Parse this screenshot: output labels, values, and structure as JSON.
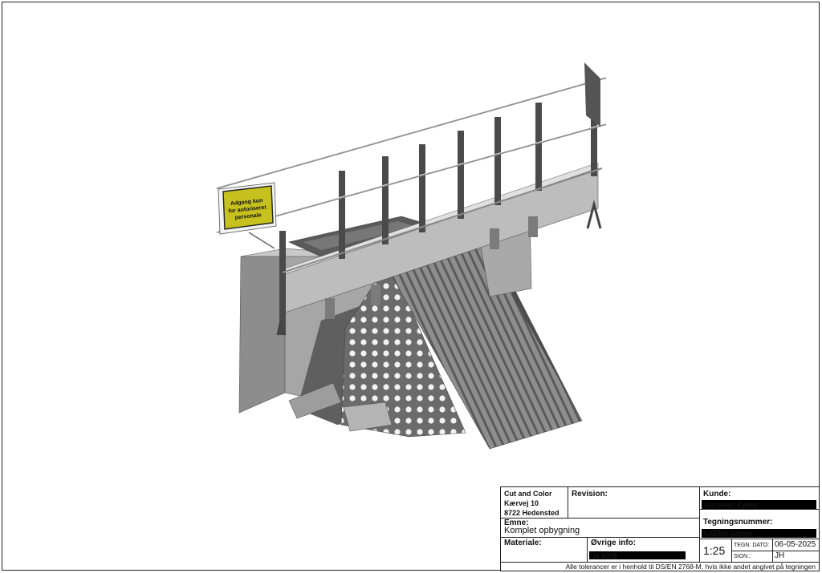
{
  "sign": {
    "line1": "Adgang kun",
    "line2": "for autoriseret",
    "line3": "personale"
  },
  "title_block": {
    "company": {
      "name": "Cut and Color",
      "street": "Kærvej 10",
      "city": "8722 Hedensted"
    },
    "revision_label": "Revision:",
    "kunde_label": "Kunde:",
    "kunde_value": "Jacobsen Kyllem",
    "emne_label": "Emne:",
    "emne_value": "Komplet opbygning",
    "tegningsnummer_label": "Tegningsnummer:",
    "tegningsnummer_value": "FAERN Samlet",
    "materiale_label": "Materiale:",
    "ovrige_label": "Øvrige info:",
    "ovrige_value": "Ja 6008",
    "scale": "1:25",
    "tegn_dato_label": "TEGN. DATO:",
    "tegn_dato_value": "06-05-2025",
    "sign_label": "SIGN.:",
    "sign_value": "JH",
    "tolerance_note": "Alle tolerancer er i henhold til DS/EN 2768-M, hvis ikke andet angivet på tegningen"
  }
}
